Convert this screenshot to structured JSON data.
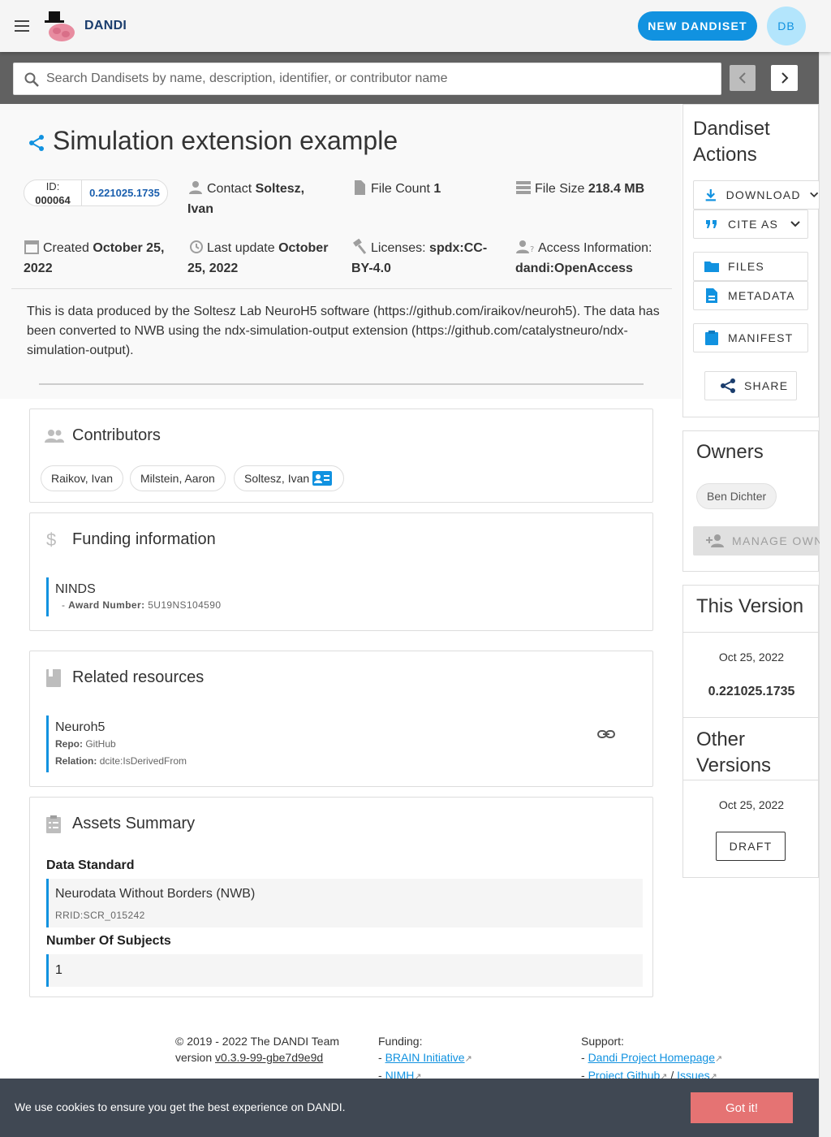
{
  "app": {
    "brand": "DANDI",
    "new_dandiset": "NEW DANDISET",
    "avatar_initials": "DB"
  },
  "search": {
    "placeholder": "Search Dandisets by name, description, identifier, or contributor name"
  },
  "dandiset": {
    "title": "Simulation extension example",
    "id_label": "ID:",
    "id": "000064",
    "version": "0.221025.1735",
    "contact_label": "Contact",
    "contact": "Soltesz, Ivan",
    "file_count_label": "File Count",
    "file_count": "1",
    "file_size_label": "File Size",
    "file_size": "218.4 MB",
    "created_label": "Created",
    "created": "October 25, 2022",
    "last_update_label": "Last update",
    "last_update": "October 25, 2022",
    "licenses_label": "Licenses:",
    "licenses": "spdx:CC-BY-4.0",
    "access_label": "Access Information:",
    "access": "dandi:OpenAccess",
    "description": "This is data produced by the Soltesz Lab NeuroH5 software (https://github.com/iraikov/neuroh5). The data has been converted to NWB using the ndx-simulation-output extension (https://github.com/catalystneuro/ndx-simulation-output)."
  },
  "contributors": {
    "title": "Contributors",
    "items": [
      "Raikov, Ivan",
      "Milstein, Aaron",
      "Soltesz, Ivan"
    ]
  },
  "funding": {
    "title": "Funding information",
    "name": "NINDS",
    "award_label": "Award Number:",
    "award": "5U19NS104590"
  },
  "related": {
    "title": "Related resources",
    "name": "Neuroh5",
    "repo_label": "Repo:",
    "repo": "GitHub",
    "relation_label": "Relation:",
    "relation": "dcite:IsDerivedFrom"
  },
  "assets": {
    "title": "Assets Summary",
    "data_standard_label": "Data Standard",
    "data_standard": "Neurodata Without Borders (NWB)",
    "rrid": "RRID:SCR_015242",
    "subjects_label": "Number Of Subjects",
    "subjects": "1"
  },
  "actions": {
    "title_line1": "Dandiset",
    "title_line2": "Actions",
    "download": "DOWNLOAD",
    "cite": "CITE AS",
    "files": "FILES",
    "metadata": "METADATA",
    "manifest": "MANIFEST",
    "share": "SHARE"
  },
  "owners": {
    "title": "Owners",
    "owner": "Ben Dichter",
    "manage": "MANAGE OWN"
  },
  "this_version": {
    "title": "This Version",
    "date": "Oct 25, 2022",
    "version": "0.221025.1735"
  },
  "other_versions": {
    "title_line1": "Other",
    "title_line2": "Versions",
    "date": "Oct 25, 2022",
    "draft": "DRAFT"
  },
  "footer": {
    "copyright": "© 2019 - 2022 The DANDI Team",
    "version_label": "version",
    "version": "v0.3.9-99-gbe7d9e9d",
    "funding_label": "Funding:",
    "funding_links": [
      "BRAIN Initiative",
      "NIMH"
    ],
    "support_label": "Support:",
    "support_links": [
      "Dandi Project Homepage",
      "Project Github",
      "Issues"
    ]
  },
  "cookie": {
    "text": "We use cookies to ensure you get the best experience on DANDI.",
    "button": "Got it!"
  },
  "colors": {
    "accent": "#1192e0",
    "brand": "#1a3d6d",
    "cookie_bg": "#404853",
    "cookie_btn": "#e57373"
  }
}
